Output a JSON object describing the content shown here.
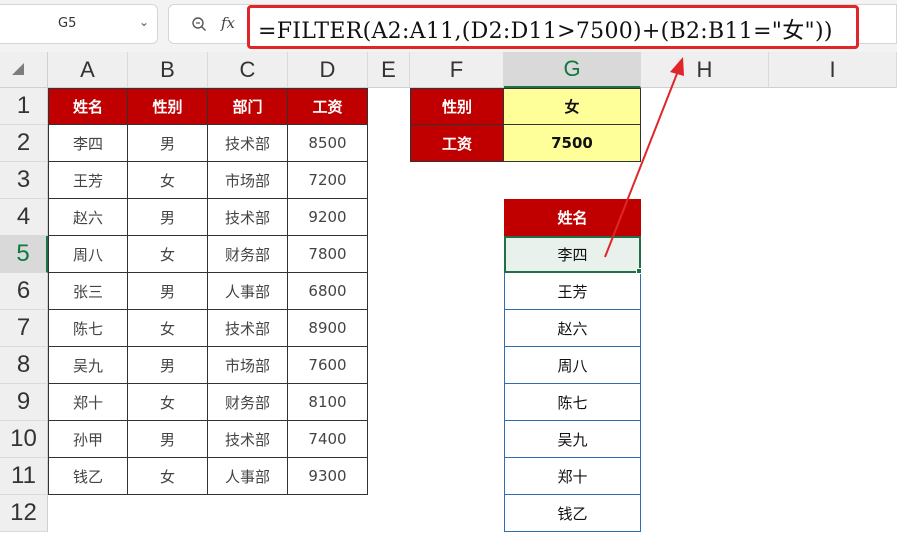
{
  "name_box": {
    "value": "G5"
  },
  "formula_bar": {
    "fx_label": "fx",
    "formula": "=FILTER(A2:A11,(D2:D11>7500)+(B2:B11=\"女\"))"
  },
  "columns": [
    "A",
    "B",
    "C",
    "D",
    "E",
    "F",
    "G",
    "H",
    "I"
  ],
  "rows": [
    "1",
    "2",
    "3",
    "4",
    "5",
    "6",
    "7",
    "8",
    "9",
    "10",
    "11",
    "12"
  ],
  "table": {
    "headers": [
      "姓名",
      "性别",
      "部门",
      "工资"
    ],
    "rows": [
      [
        "李四",
        "男",
        "技术部",
        "8500"
      ],
      [
        "王芳",
        "女",
        "市场部",
        "7200"
      ],
      [
        "赵六",
        "男",
        "技术部",
        "9200"
      ],
      [
        "周八",
        "女",
        "财务部",
        "7800"
      ],
      [
        "张三",
        "男",
        "人事部",
        "6800"
      ],
      [
        "陈七",
        "女",
        "技术部",
        "8900"
      ],
      [
        "吴九",
        "男",
        "市场部",
        "7600"
      ],
      [
        "郑十",
        "女",
        "财务部",
        "8100"
      ],
      [
        "孙甲",
        "男",
        "技术部",
        "7400"
      ],
      [
        "钱乙",
        "女",
        "人事部",
        "9300"
      ]
    ]
  },
  "criteria": [
    {
      "label": "性别",
      "value": "女"
    },
    {
      "label": "工资",
      "value": "7500"
    }
  ],
  "result": {
    "header": "姓名",
    "values": [
      "李四",
      "王芳",
      "赵六",
      "周八",
      "陈七",
      "吴九",
      "郑十",
      "钱乙"
    ]
  },
  "colors": {
    "header_red": "#c00000",
    "criteria_yellow": "#ffff99",
    "highlight_red": "#e0262a",
    "select_green": "#1e7145"
  }
}
